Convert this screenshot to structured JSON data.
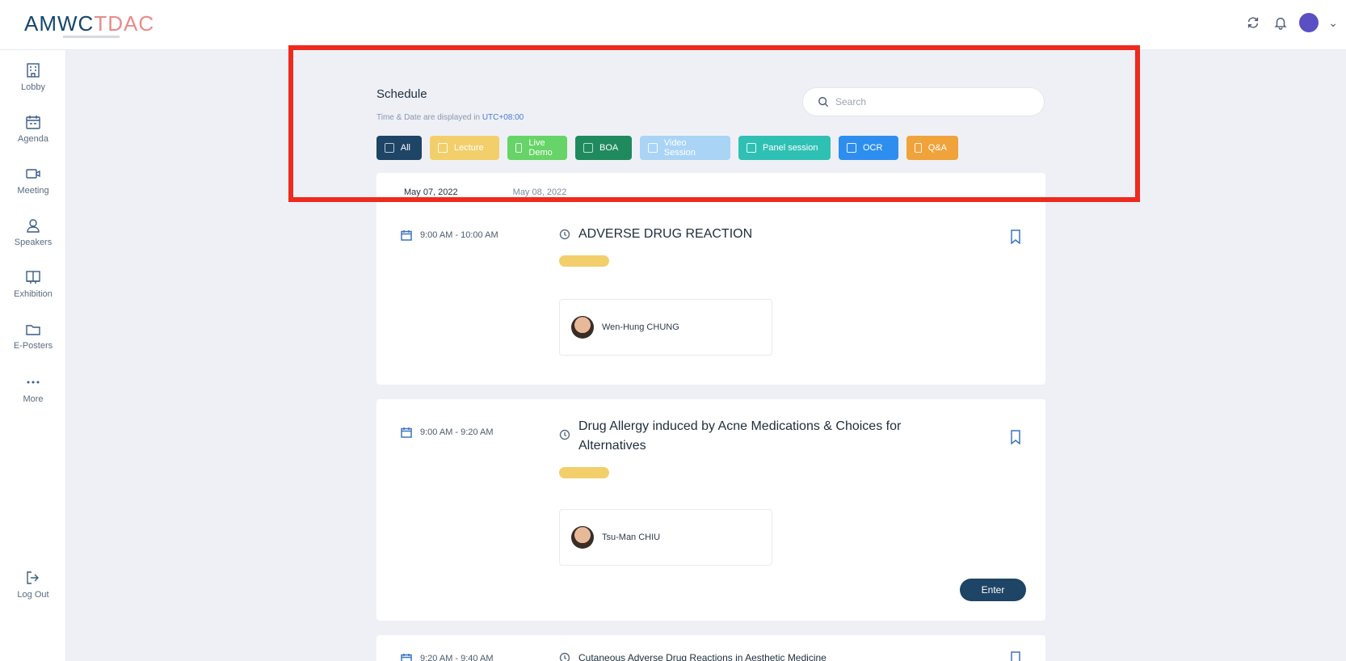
{
  "app": {
    "logo_text_main": "AMWC",
    "logo_text_accent": "TDAC"
  },
  "topbar": {
    "icons": [
      "sync-icon",
      "bell-icon",
      "avatar-icon",
      "chevron-down-icon"
    ]
  },
  "sidebar": {
    "items": [
      {
        "label": "Lobby",
        "icon": "building-icon"
      },
      {
        "label": "Agenda",
        "icon": "calendar-icon"
      },
      {
        "label": "Meeting",
        "icon": "video-icon"
      },
      {
        "label": "Speakers",
        "icon": "user-icon"
      },
      {
        "label": "Exhibition",
        "icon": "booth-icon"
      },
      {
        "label": "E-Posters",
        "icon": "folder-icon"
      },
      {
        "label": "More",
        "icon": "more-icon"
      }
    ],
    "logout": {
      "label": "Log Out",
      "icon": "logout-icon"
    }
  },
  "schedule": {
    "title": "Schedule",
    "timezone_prefix": "Time & Date are displayed in",
    "timezone_value": "UTC+08:00",
    "search_placeholder": "Search",
    "filters": [
      {
        "label": "All",
        "color": "#1e4466"
      },
      {
        "label": "Lecture",
        "color": "#f2cf6b"
      },
      {
        "label": "Live Demo",
        "color": "#66d466"
      },
      {
        "label": "BOA",
        "color": "#1f8a5e"
      },
      {
        "label": "Video Session",
        "color": "#a9d4f5"
      },
      {
        "label": "Panel session",
        "color": "#2fc0b4"
      },
      {
        "label": "OCR",
        "color": "#2e8ef0"
      },
      {
        "label": "Q&A",
        "color": "#f0a23b"
      }
    ],
    "tabs": [
      {
        "label": "May 07, 2022"
      },
      {
        "label": "May 08, 2022"
      }
    ]
  },
  "sessions": [
    {
      "time": "9:00 AM - 10:00 AM",
      "title": "ADVERSE DRUG REACTION",
      "speaker": "Wen-Hung CHUNG"
    },
    {
      "time": "9:00 AM - 9:20 AM",
      "title": "Drug Allergy induced by Acne Medications & Choices for Alternatives",
      "speaker": "Tsu-Man CHIU",
      "action": "Enter"
    },
    {
      "time": "9:20 AM - 9:40 AM",
      "title": "Cutaneous Adverse Drug Reactions in Aesthetic Medicine"
    }
  ]
}
